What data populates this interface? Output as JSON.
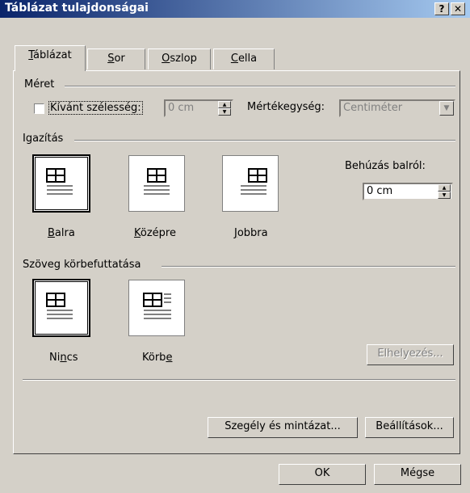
{
  "window": {
    "title": "Táblázat tulajdonságai",
    "help_label": "?",
    "close_label": "✕"
  },
  "tabs": [
    {
      "pre": "",
      "key": "T",
      "rest": "áblázat"
    },
    {
      "pre": "",
      "key": "S",
      "rest": "or"
    },
    {
      "pre": "",
      "key": "O",
      "rest": "szlop"
    },
    {
      "pre": "",
      "key": "C",
      "rest": "ella"
    }
  ],
  "size": {
    "group_label": "Méret",
    "preferred_width_label": "Kívánt szélesség:",
    "preferred_width_checked": false,
    "width_value": "0 cm",
    "unit_label": "Mértékegység:",
    "unit_value": "Centiméter"
  },
  "alignment": {
    "group_label": "Igazítás",
    "options": [
      {
        "pre": "",
        "key": "B",
        "rest": "alra",
        "selected": true
      },
      {
        "pre": "",
        "key": "K",
        "rest": "özépre",
        "selected": false
      },
      {
        "pre": "",
        "key": "J",
        "rest": "obbra",
        "selected": false
      }
    ],
    "indent_label": "Behúzás balról:",
    "indent_value": "0 cm"
  },
  "wrapping": {
    "group_label": "Szöveg körbefuttatása",
    "options": [
      {
        "pre": "Ni",
        "key": "n",
        "rest": "cs",
        "selected": true
      },
      {
        "pre": "Körb",
        "key": "e",
        "rest": "",
        "selected": false
      }
    ],
    "position_button": "Elhelyezés..."
  },
  "buttons": {
    "borders": "Szegély és mintázat...",
    "options": "Beállítások...",
    "ok": "OK",
    "cancel": "Mégse"
  }
}
